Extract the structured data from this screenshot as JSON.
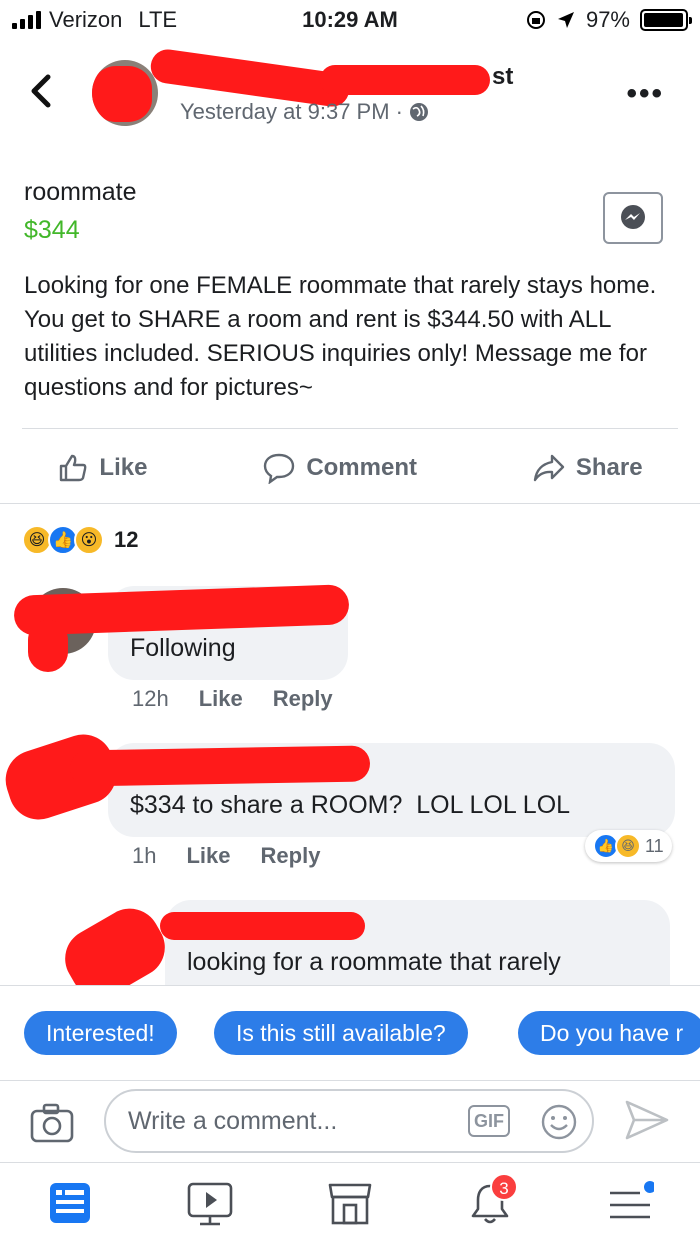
{
  "status_bar": {
    "carrier": "Verizon",
    "network": "LTE",
    "time": "10:29 AM",
    "battery": "97%",
    "battery_level": 0.97
  },
  "post_header": {
    "name_visible_suffix": "st",
    "timestamp": "Yesterday at 9:37 PM ·"
  },
  "listing": {
    "title": "roommate",
    "price": "$344",
    "description": "Looking for one FEMALE roommate that rarely stays home. You get to SHARE a room and rent is $344.50 with ALL utilities included. SERIOUS inquiries only! Message me for questions and for pictures~"
  },
  "actions": {
    "like": "Like",
    "comment": "Comment",
    "share": "Share"
  },
  "reactions": {
    "count": "12"
  },
  "comments": [
    {
      "text": "Following",
      "time": "12h",
      "like": "Like",
      "reply": "Reply"
    },
    {
      "text": "$334 to share a ROOM?  LOL LOL LOL",
      "time": "1h",
      "like": "Like",
      "reply": "Reply",
      "reaction_count": "11"
    },
    {
      "text": "looking for a roommate that rarely"
    }
  ],
  "quick_replies": [
    "Interested!",
    "Is this still available?",
    "Do you have r"
  ],
  "composer": {
    "placeholder": "Write a comment...",
    "gif_label": "GIF"
  },
  "tabbar": {
    "notifications_badge": "3"
  },
  "colors": {
    "price_green": "#42b72a",
    "accent_blue": "#1877f2",
    "redaction_red": "#ff1a1a"
  }
}
